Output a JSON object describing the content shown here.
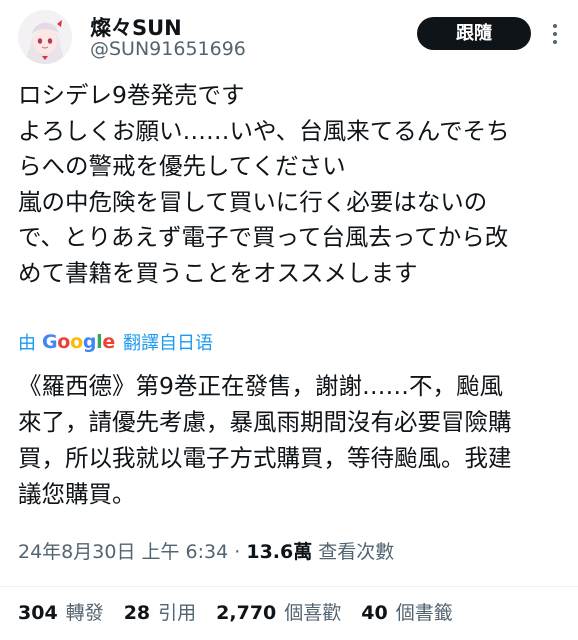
{
  "author": {
    "display_name": "燦々SUN",
    "handle": "@SUN91651696"
  },
  "follow_label": "跟隨",
  "more_icon": "more-vertical-icon",
  "tweet_text": "ロシデレ9巻発売です\nよろしくお願い……いや、台風来てるんでそち\nらへの警戒を優先してください\n嵐の中危険を冒して買いに行く必要はないの\nで、とりあえず電子で買って台風去ってから改\nめて書籍を買うことをオススメします",
  "translation": {
    "by": "由",
    "google": [
      "G",
      "o",
      "o",
      "g",
      "l",
      "e"
    ],
    "label": "翻譯自日语",
    "text": "《羅西德》第9巻正在發售，謝謝……不，颱風\n來了，請優先考慮，暴風雨期間沒有必要冒險購\n買，所以我就以電子方式購買，等待颱風。我建\n議您購買。"
  },
  "meta": {
    "datetime": "24年8月30日 上午 6:34",
    "separator": "·",
    "views_count": "13.6萬",
    "views_label": "查看次數"
  },
  "stats": {
    "retweets_count": "304",
    "retweets_label": "轉發",
    "quotes_count": "28",
    "quotes_label": "引用",
    "likes_count": "2,770",
    "likes_label": "個喜歡",
    "bookmarks_count": "40",
    "bookmarks_label": "個書籤"
  },
  "colors": {
    "accent": "#1d9bf0",
    "secondary_text": "#536471",
    "button_bg": "#0f1419"
  }
}
